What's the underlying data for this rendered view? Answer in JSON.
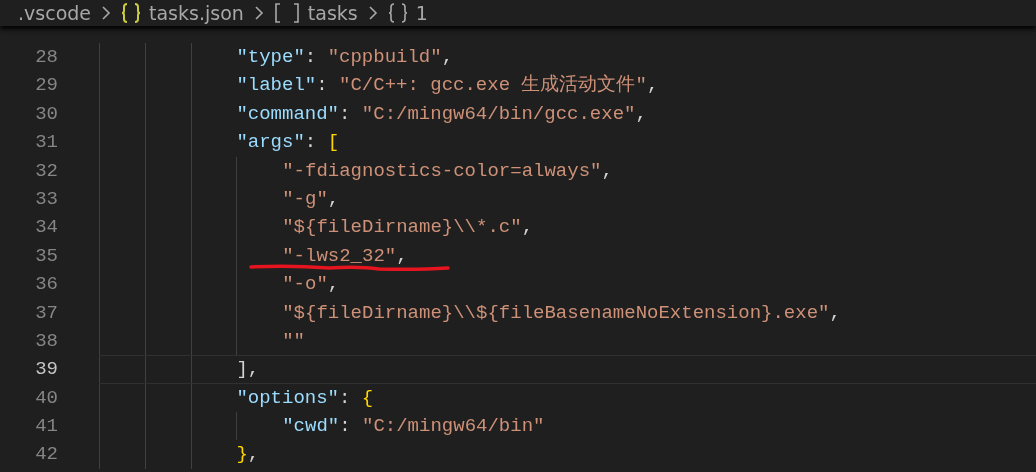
{
  "breadcrumbs": [
    {
      "kind": "folder",
      "label": ".vscode"
    },
    {
      "kind": "file",
      "label": "tasks.json"
    },
    {
      "kind": "array",
      "label": "tasks"
    },
    {
      "kind": "object",
      "label": "1"
    }
  ],
  "lines": [
    {
      "number": "28",
      "current": false,
      "underlined": false,
      "tokens": [
        {
          "kind": "key",
          "text": "\"type\""
        },
        {
          "kind": "punct",
          "text": ": "
        },
        {
          "kind": "string",
          "text": "\"cppbuild\""
        },
        {
          "kind": "punct",
          "text": ","
        }
      ]
    },
    {
      "number": "29",
      "current": false,
      "underlined": false,
      "tokens": [
        {
          "kind": "key",
          "text": "\"label\""
        },
        {
          "kind": "punct",
          "text": ": "
        },
        {
          "kind": "string",
          "text": "\"C/C++: gcc.exe 生成活动文件\""
        },
        {
          "kind": "punct",
          "text": ","
        }
      ]
    },
    {
      "number": "30",
      "current": false,
      "underlined": false,
      "tokens": [
        {
          "kind": "key",
          "text": "\"command\""
        },
        {
          "kind": "punct",
          "text": ": "
        },
        {
          "kind": "string",
          "text": "\"C:/mingw64/bin/gcc.exe\""
        },
        {
          "kind": "punct",
          "text": ","
        }
      ]
    },
    {
      "number": "31",
      "current": false,
      "underlined": false,
      "tokens": [
        {
          "kind": "key",
          "text": "\"args\""
        },
        {
          "kind": "punct",
          "text": ": "
        },
        {
          "kind": "bracket1",
          "text": "["
        }
      ],
      "children": [
        {
          "number": "32",
          "current": false,
          "underlined": false,
          "tokens": [
            {
              "kind": "string",
              "text": "\"-fdiagnostics-color=always\""
            },
            {
              "kind": "punct",
              "text": ","
            }
          ]
        },
        {
          "number": "33",
          "current": false,
          "underlined": false,
          "tokens": [
            {
              "kind": "string",
              "text": "\"-g\""
            },
            {
              "kind": "punct",
              "text": ","
            }
          ]
        },
        {
          "number": "34",
          "current": false,
          "underlined": false,
          "tokens": [
            {
              "kind": "string",
              "text": "\"${fileDirname}\\\\*.c\""
            },
            {
              "kind": "punct",
              "text": ","
            }
          ]
        },
        {
          "number": "35",
          "current": false,
          "underlined": true,
          "tokens": [
            {
              "kind": "string",
              "text": "\"-lws2_32\""
            },
            {
              "kind": "punct",
              "text": ","
            }
          ]
        },
        {
          "number": "36",
          "current": false,
          "underlined": false,
          "tokens": [
            {
              "kind": "string",
              "text": "\"-o\""
            },
            {
              "kind": "punct",
              "text": ","
            }
          ]
        },
        {
          "number": "37",
          "current": false,
          "underlined": false,
          "tokens": [
            {
              "kind": "string",
              "text": "\"${fileDirname}\\\\${fileBasenameNoExtension}.exe\""
            },
            {
              "kind": "punct",
              "text": ","
            }
          ]
        },
        {
          "number": "38",
          "current": false,
          "underlined": false,
          "tokens": [
            {
              "kind": "string",
              "text": "\"\""
            }
          ]
        }
      ]
    },
    {
      "number": "39",
      "current": true,
      "underlined": false,
      "tokens": [
        {
          "kind": "punct",
          "text": "],"
        }
      ]
    },
    {
      "number": "40",
      "current": false,
      "underlined": false,
      "tokens": [
        {
          "kind": "key",
          "text": "\"options\""
        },
        {
          "kind": "punct",
          "text": ": "
        },
        {
          "kind": "bracket1",
          "text": "{"
        }
      ],
      "children": [
        {
          "number": "41",
          "current": false,
          "underlined": false,
          "tokens": [
            {
              "kind": "key",
              "text": "\"cwd\""
            },
            {
              "kind": "punct",
              "text": ": "
            },
            {
              "kind": "string",
              "text": "\"C:/mingw64/bin\""
            }
          ]
        }
      ]
    },
    {
      "number": "42",
      "current": false,
      "underlined": false,
      "tokens": [
        {
          "kind": "bracket1",
          "text": "}"
        },
        {
          "kind": "punct",
          "text": ","
        }
      ]
    }
  ]
}
